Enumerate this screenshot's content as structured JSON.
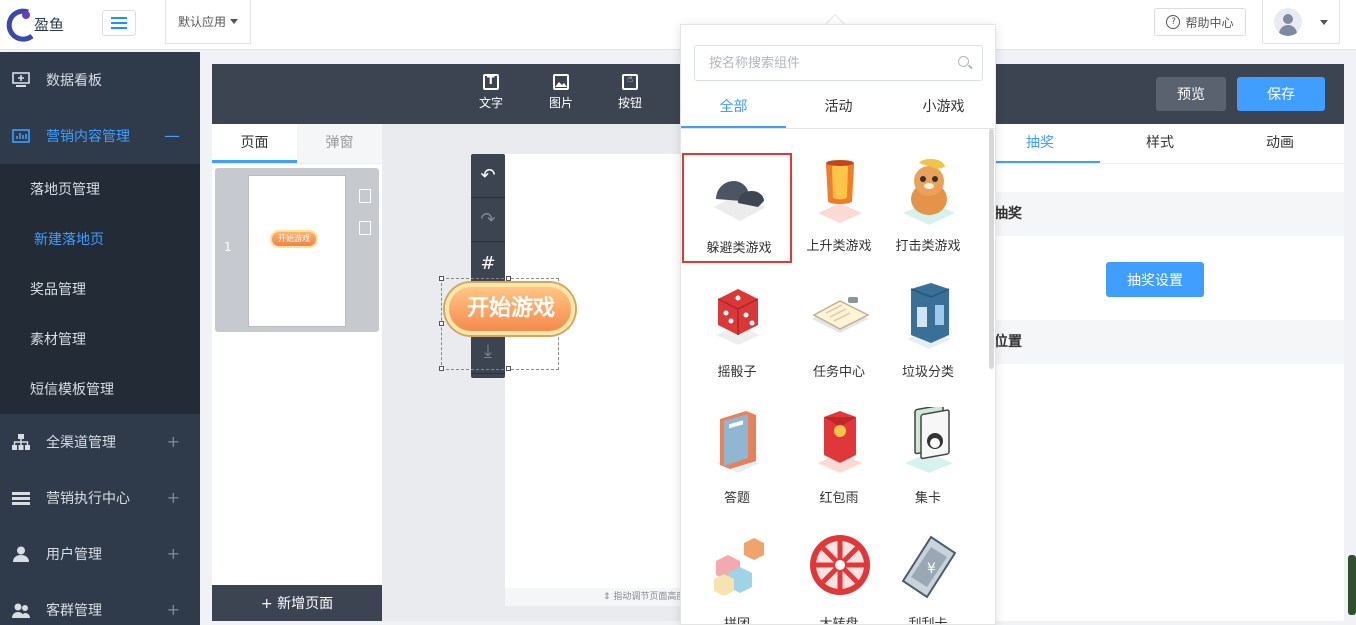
{
  "app": {
    "logo_text": "盈鱼",
    "app_select": "默认应用",
    "help": "帮助中心"
  },
  "sidebar": {
    "items": [
      {
        "label": "数据看板",
        "icon": "monitor-icon"
      },
      {
        "label": "营销内容管理",
        "icon": "bar-chart-icon",
        "toggle": "—"
      },
      {
        "label": "全渠道管理",
        "icon": "org-chart-icon",
        "toggle": "+"
      },
      {
        "label": "营销执行中心",
        "icon": "list-icon",
        "toggle": "+"
      },
      {
        "label": "用户管理",
        "icon": "user-icon",
        "toggle": "+"
      },
      {
        "label": "客群管理",
        "icon": "group-icon",
        "toggle": "+"
      }
    ],
    "sub_items": [
      "落地页管理",
      "新建落地页",
      "奖品管理",
      "素材管理",
      "短信模板管理"
    ]
  },
  "toolbar": {
    "tools": [
      "文字",
      "图片",
      "按钮"
    ],
    "preview": "预览",
    "save": "保存"
  },
  "pages_panel": {
    "tabs": [
      "页面",
      "弹窗"
    ],
    "page_number": "1",
    "thumb_button": "开始游戏",
    "add_page": "+ 新增页面"
  },
  "canvas": {
    "side_tools": [
      "↶",
      "↷",
      "#",
      "⤒",
      "⤓"
    ],
    "start_button": "开始游戏",
    "drag_hint": "⇕ 指动调节页面高度"
  },
  "props": {
    "tabs": [
      "抽奖",
      "样式",
      "动画"
    ],
    "section1": "抽奖",
    "lottery_button": "抽奖设置",
    "section2": "位置"
  },
  "popover": {
    "search_placeholder": "按名称搜索组件",
    "tabs": [
      "全部",
      "活动",
      "小游戏"
    ],
    "components": [
      {
        "label": "躲避类游戏",
        "icon": "rocks-icon"
      },
      {
        "label": "上升类游戏",
        "icon": "lantern-icon"
      },
      {
        "label": "打击类游戏",
        "icon": "mole-icon"
      },
      {
        "label": "摇骰子",
        "icon": "dice-icon"
      },
      {
        "label": "任务中心",
        "icon": "clipboard-icon"
      },
      {
        "label": "垃圾分类",
        "icon": "trash-bin-icon"
      },
      {
        "label": "答题",
        "icon": "book-icon"
      },
      {
        "label": "红包雨",
        "icon": "red-envelope-icon"
      },
      {
        "label": "集卡",
        "icon": "cards-icon"
      },
      {
        "label": "拼团",
        "icon": "cubes-icon"
      },
      {
        "label": "大转盘",
        "icon": "wheel-icon"
      },
      {
        "label": "刮刮卡",
        "icon": "scratch-card-icon"
      }
    ]
  },
  "colors": {
    "accent": "#409eff",
    "sidebar_bg": "#2f3b4a",
    "toolbar_bg": "#3c4451",
    "selection": "#e63737"
  }
}
